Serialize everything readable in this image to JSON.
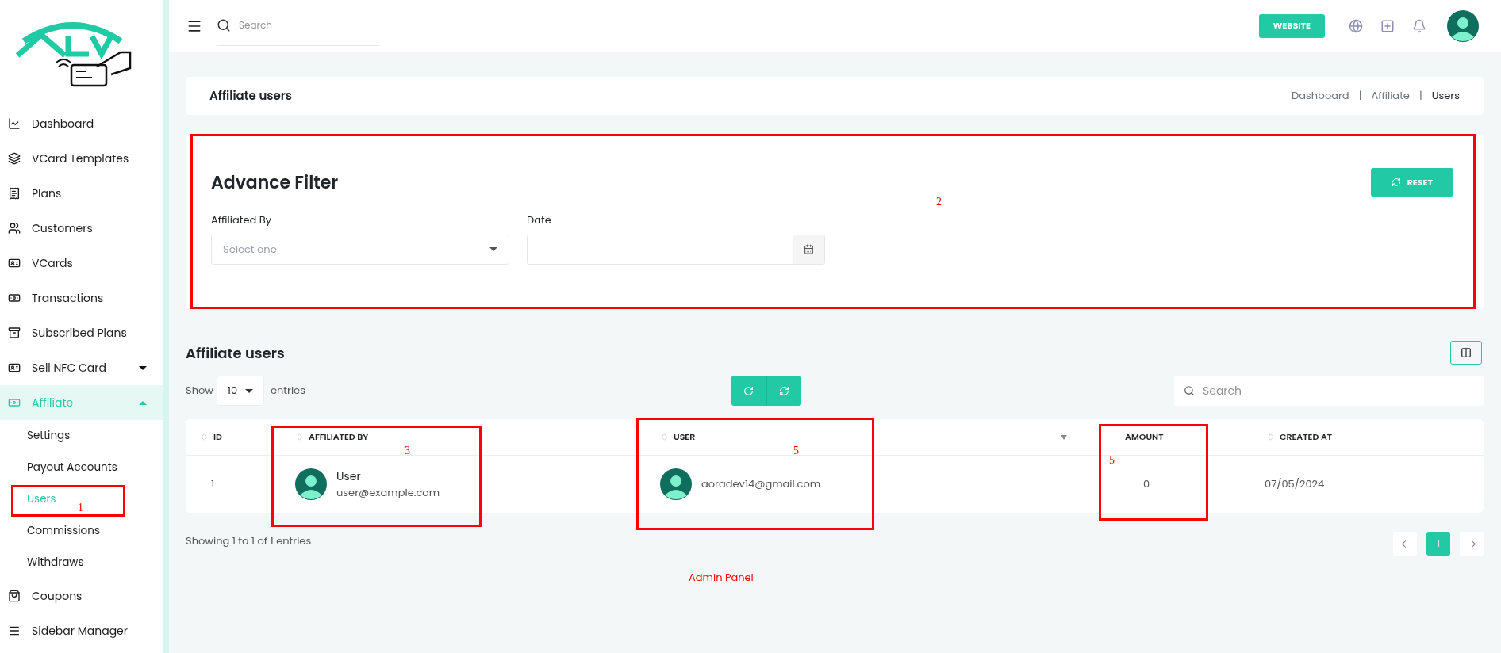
{
  "sidebar": {
    "items": [
      {
        "label": "Dashboard",
        "selected": false
      },
      {
        "label": "VCard Templates",
        "selected": false
      },
      {
        "label": "Plans",
        "selected": false
      },
      {
        "label": "Customers",
        "selected": false
      },
      {
        "label": "VCards",
        "selected": false
      },
      {
        "label": "Transactions",
        "selected": false
      },
      {
        "label": "Subscribed Plans",
        "selected": false
      },
      {
        "label": "Sell NFC Card",
        "selected": false,
        "expanded": false
      },
      {
        "label": "Affiliate",
        "selected": true,
        "expanded": true,
        "children": [
          {
            "label": "Settings",
            "selected": false
          },
          {
            "label": "Payout Accounts",
            "selected": false
          },
          {
            "label": "Users",
            "selected": true
          },
          {
            "label": "Commissions",
            "selected": false
          },
          {
            "label": "Withdraws",
            "selected": false
          }
        ]
      },
      {
        "label": "Coupons",
        "selected": false
      },
      {
        "label": "Sidebar Manager",
        "selected": false
      }
    ]
  },
  "topbar": {
    "search": {
      "placeholder": "Search"
    },
    "website_button": "WEBSITE"
  },
  "page_header": {
    "title": "Affiliate users",
    "breadcrumbs": [
      "Dashboard",
      "Affiliate",
      "Users"
    ],
    "separator": "|"
  },
  "filter": {
    "title": "Advance Filter",
    "reset_button": "RESET",
    "fields": [
      {
        "label": "Affiliated By",
        "kind": "select",
        "placeholder": "Select one"
      },
      {
        "label": "Date",
        "kind": "date"
      }
    ]
  },
  "table": {
    "title": "Affiliate users",
    "show_label": "Show",
    "page_size": "10",
    "entries_label": "entries",
    "search": {
      "placeholder": "Search"
    },
    "columns": [
      "ID",
      "AFFILIATED BY",
      "USER",
      "AMOUNT",
      "CREATED AT"
    ],
    "rows": [
      {
        "id": "1",
        "affiliated_by": {
          "name": "User",
          "email": "user@example.com"
        },
        "user": "aoradev14@gmail.com",
        "amount": "0",
        "created_at": "07/05/2024"
      }
    ],
    "footer": "Showing 1 to 1 of 1 entries",
    "pages": [
      {
        "label": "1",
        "selected": true
      }
    ]
  },
  "annotations": {
    "boxes": [
      {
        "label": "1"
      },
      {
        "label": "2"
      },
      {
        "label": "3"
      },
      {
        "label": "5"
      },
      {
        "label": "5"
      }
    ],
    "caption": "Admin Panel"
  }
}
